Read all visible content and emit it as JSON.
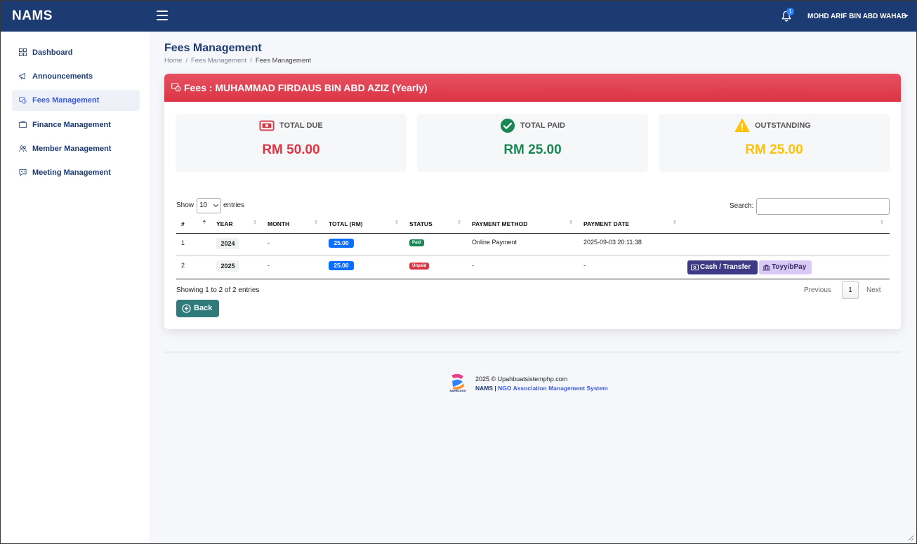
{
  "app": {
    "brand": "NAMS"
  },
  "header": {
    "user_name": "MOHD ARIF BIN ABD WAHAB",
    "notification_count": "1"
  },
  "sidebar": {
    "items": [
      {
        "label": "Dashboard",
        "icon": "grid-icon",
        "active": false
      },
      {
        "label": "Announcements",
        "icon": "megaphone-icon",
        "active": false
      },
      {
        "label": "Fees Management",
        "icon": "fee-icon",
        "active": true
      },
      {
        "label": "Finance Management",
        "icon": "wallet-icon",
        "active": false
      },
      {
        "label": "Member Management",
        "icon": "users-icon",
        "active": false
      },
      {
        "label": "Meeting Management",
        "icon": "chat-icon",
        "active": false
      }
    ]
  },
  "page": {
    "title": "Fees Management",
    "breadcrumb": [
      "Home",
      "Fees Management",
      "Fees Management"
    ]
  },
  "card": {
    "title": "Fees : MUHAMMAD FIRDAUS BIN ABD AZIZ (Yearly)",
    "stats": [
      {
        "label": "TOTAL DUE",
        "value": "RM 50.00",
        "color": "#dc3545",
        "icon": "money-icon"
      },
      {
        "label": "TOTAL PAID",
        "value": "RM 25.00",
        "color": "#198754",
        "icon": "check-circle-icon"
      },
      {
        "label": "OUTSTANDING",
        "value": "RM 25.00",
        "color": "#ffc107",
        "icon": "warning-icon"
      }
    ]
  },
  "table": {
    "show_label": "Show",
    "page_size": "10",
    "entries_label": "entries",
    "search_label": "Search:",
    "columns": [
      "#",
      "YEAR",
      "MONTH",
      "TOTAL (RM)",
      "STATUS",
      "PAYMENT METHOD",
      "PAYMENT DATE",
      ""
    ],
    "rows": [
      {
        "no": "1",
        "year": "2024",
        "month": "-",
        "total": "25.00",
        "status": "Paid",
        "status_color": "#198754",
        "method": "Online Payment",
        "date": "2025-09-03 20:11:38"
      },
      {
        "no": "2",
        "year": "2025",
        "month": "-",
        "total": "25.00",
        "status": "Unpaid",
        "status_color": "#dc3545",
        "method": "-",
        "date": "-"
      }
    ],
    "actions": {
      "cash_label": "Cash / Transfer",
      "toyyib_label": "ToyyibPay"
    },
    "info": "Showing 1 to 2 of 2 entries",
    "pagination": {
      "previous": "Previous",
      "current": "1",
      "next": "Next"
    }
  },
  "back_label": "Back",
  "footer": {
    "copyright": "2025 © Upahbuatsistemphp.com",
    "system_brand": "NAMS |",
    "system_name": "NGO Association Management System",
    "logo_text": "NAMELOGO"
  },
  "colors": {
    "navbar": "#1c3b72",
    "card_header": "#dc3545",
    "accent": "#3b5bdb"
  }
}
